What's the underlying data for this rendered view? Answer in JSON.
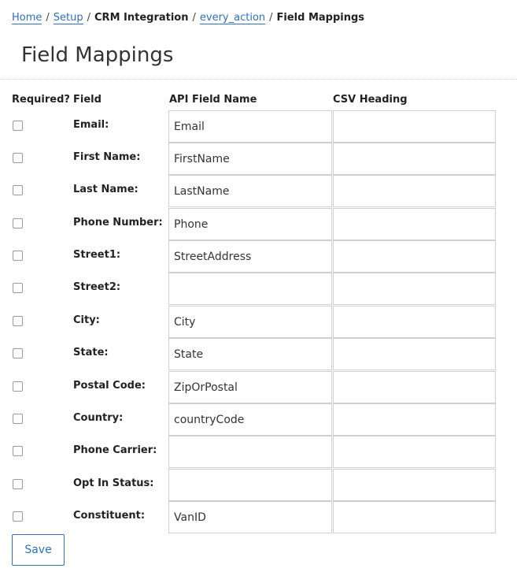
{
  "breadcrumb": {
    "items": [
      {
        "label": "Home",
        "link": true
      },
      {
        "label": "Setup",
        "link": true
      },
      {
        "label": "CRM Integration",
        "link": false
      },
      {
        "label": "every_action",
        "link": true
      },
      {
        "label": "Field Mappings",
        "link": false
      }
    ],
    "separator": "/"
  },
  "page": {
    "title": "Field Mappings"
  },
  "table": {
    "headers": {
      "required": "Required?",
      "field": "Field",
      "api_field_name": "API Field Name",
      "csv_heading": "CSV Heading"
    },
    "rows": [
      {
        "field": "Email:",
        "api": "Email",
        "csv": "",
        "required": false
      },
      {
        "field": "First Name:",
        "api": "FirstName",
        "csv": "",
        "required": false
      },
      {
        "field": "Last Name:",
        "api": "LastName",
        "csv": "",
        "required": false
      },
      {
        "field": "Phone Number:",
        "api": "Phone",
        "csv": "",
        "required": false
      },
      {
        "field": "Street1:",
        "api": "StreetAddress",
        "csv": "",
        "required": false
      },
      {
        "field": "Street2:",
        "api": "",
        "csv": "",
        "required": false
      },
      {
        "field": "City:",
        "api": "City",
        "csv": "",
        "required": false
      },
      {
        "field": "State:",
        "api": "State",
        "csv": "",
        "required": false
      },
      {
        "field": "Postal Code:",
        "api": "ZipOrPostal",
        "csv": "",
        "required": false
      },
      {
        "field": "Country:",
        "api": "countryCode",
        "csv": "",
        "required": false
      },
      {
        "field": "Phone Carrier:",
        "api": "",
        "csv": "",
        "required": false
      },
      {
        "field": "Opt In Status:",
        "api": "",
        "csv": "",
        "required": false
      },
      {
        "field": "Constituent:",
        "api": "VanID",
        "csv": "",
        "required": false
      }
    ]
  },
  "actions": {
    "save_label": "Save"
  },
  "colors": {
    "link": "#2f6fb6",
    "border": "#cfcfcf",
    "text": "#222222"
  }
}
